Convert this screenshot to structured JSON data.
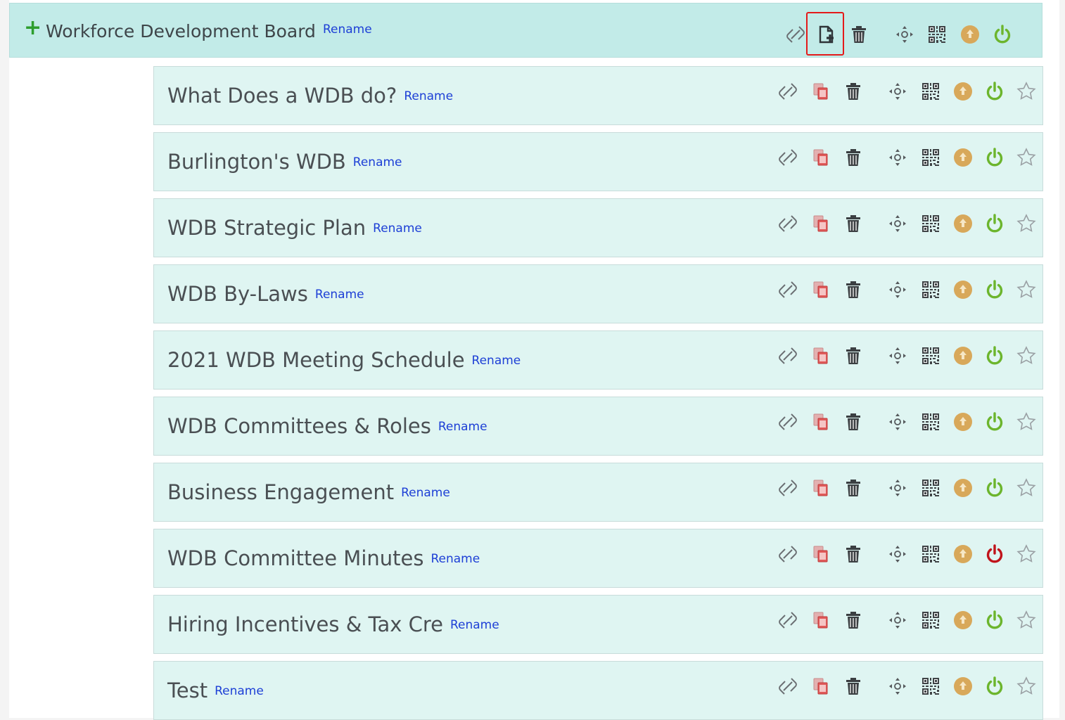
{
  "header": {
    "plus_symbol": "+",
    "title": "Workforce Development Board",
    "rename_label": "Rename"
  },
  "rows": [
    {
      "label": "What Does a WDB do?",
      "rename_label": "Rename",
      "power_state": "on"
    },
    {
      "label": "Burlington's WDB",
      "rename_label": "Rename",
      "power_state": "on"
    },
    {
      "label": "WDB Strategic Plan",
      "rename_label": "Rename",
      "power_state": "on"
    },
    {
      "label": "WDB By-Laws",
      "rename_label": "Rename",
      "power_state": "on"
    },
    {
      "label": "2021 WDB Meeting Schedule",
      "rename_label": "Rename",
      "power_state": "on"
    },
    {
      "label": "WDB Committees & Roles",
      "rename_label": "Rename",
      "power_state": "on"
    },
    {
      "label": "Business Engagement",
      "rename_label": "Rename",
      "power_state": "on"
    },
    {
      "label": "WDB Committee Minutes",
      "rename_label": "Rename",
      "power_state": "off"
    },
    {
      "label": "Hiring Incentives & Tax Cre",
      "rename_label": "Rename",
      "power_state": "on"
    },
    {
      "label": "Test",
      "rename_label": "Rename",
      "power_state": "on"
    }
  ],
  "icons": {
    "header": [
      "link-icon",
      "add-page-icon",
      "trash-icon",
      "move-icon",
      "qr-code-icon",
      "move-up-icon",
      "power-icon"
    ],
    "row": [
      "link-icon",
      "copy-icon",
      "trash-icon",
      "move-icon",
      "qr-code-icon",
      "move-up-icon",
      "power-icon",
      "star-icon"
    ]
  },
  "colors": {
    "header_bg": "#c2ebe8",
    "row_bg": "#dff5f2",
    "rename_link": "#1d3fd6",
    "power_on": "#6cb52d",
    "power_off": "#c0141b",
    "up_circle": "#d8a85a",
    "highlight_box": "#e41a1a"
  }
}
